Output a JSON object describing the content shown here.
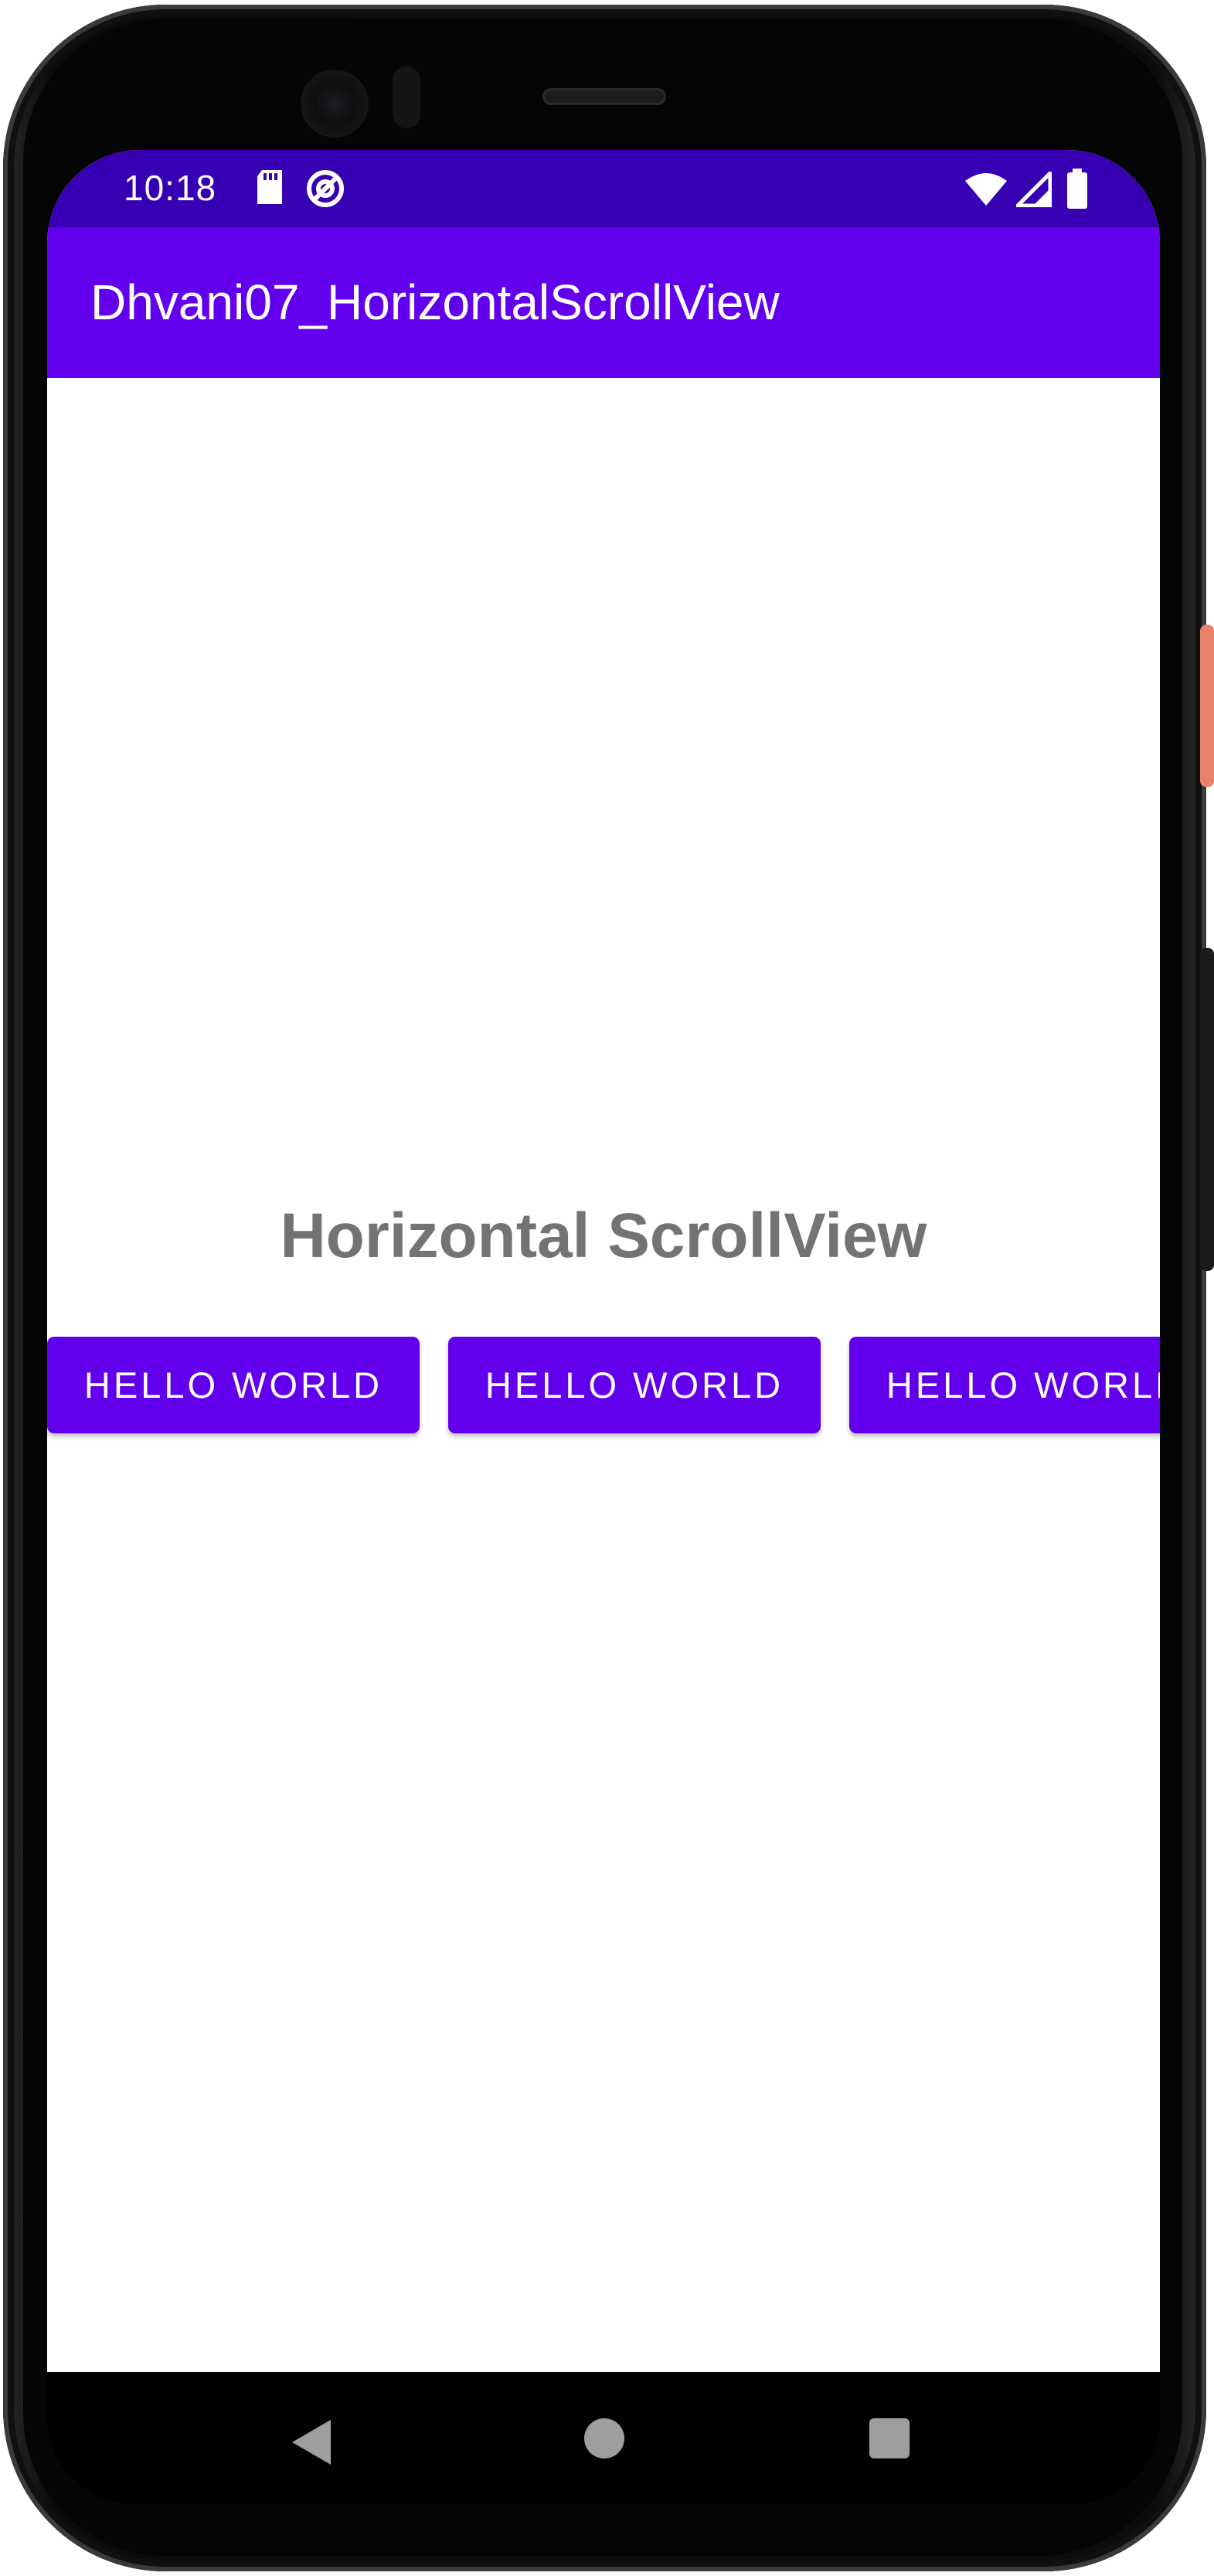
{
  "status_bar": {
    "time": "10:18",
    "icons": [
      "sd-card-icon",
      "at-sign-icon",
      "wifi-icon",
      "signal-icon",
      "battery-icon"
    ]
  },
  "app_bar": {
    "title": "Dhvani07_HorizontalScrollView"
  },
  "main": {
    "heading": "Horizontal ScrollView",
    "buttons": [
      {
        "label": "HELLO WORLD"
      },
      {
        "label": "HELLO WORLD"
      },
      {
        "label": "HELLO WORLD"
      }
    ]
  },
  "nav_bar": {
    "icons": [
      "back-icon",
      "home-icon",
      "recents-icon"
    ]
  },
  "colors": {
    "primary": "#6200ee",
    "primary_dark": "#3700b3",
    "heading_text": "#737373",
    "on_primary": "#ffffff"
  }
}
